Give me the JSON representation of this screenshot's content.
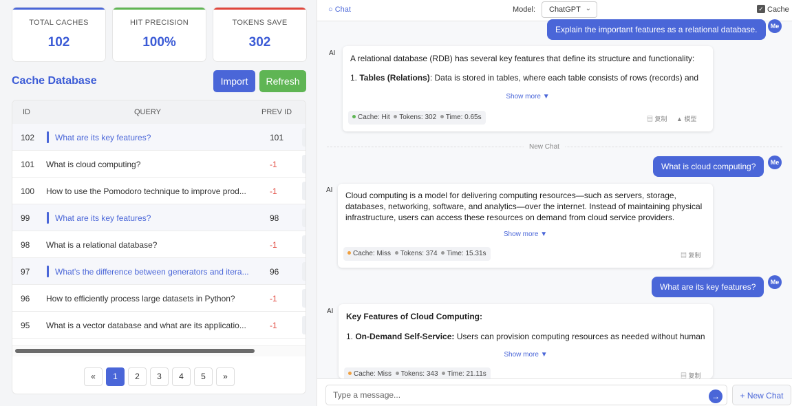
{
  "stats": [
    {
      "label": "TOTAL CACHES",
      "value": "102",
      "color": "#4a66d8"
    },
    {
      "label": "HIT PRECISION",
      "value": "100%",
      "color": "#5fb554"
    },
    {
      "label": "TOKENS SAVE",
      "value": "302",
      "color": "#e0463c"
    }
  ],
  "cache_db": {
    "title": "Cache Database",
    "import_label": "Import",
    "refresh_label": "Refresh",
    "columns": {
      "id": "ID",
      "query": "QUERY",
      "prev_id": "PREV ID"
    },
    "rows": [
      {
        "id": "102",
        "query": "What are its key features?",
        "prev_id": "101",
        "linked": true
      },
      {
        "id": "101",
        "query": "What is cloud computing?",
        "prev_id": "-1",
        "linked": false
      },
      {
        "id": "100",
        "query": "How to use the Pomodoro technique to improve prod...",
        "prev_id": "-1",
        "linked": false
      },
      {
        "id": "99",
        "query": "What are its key features?",
        "prev_id": "98",
        "linked": true
      },
      {
        "id": "98",
        "query": "What is a relational database?",
        "prev_id": "-1",
        "linked": false
      },
      {
        "id": "97",
        "query": "What's the difference between generators and itera...",
        "prev_id": "96",
        "linked": true
      },
      {
        "id": "96",
        "query": "How to efficiently process large datasets in Python?",
        "prev_id": "-1",
        "linked": false
      },
      {
        "id": "95",
        "query": "What is a vector database and what are its applicatio...",
        "prev_id": "-1",
        "linked": false
      }
    ],
    "pagination": {
      "prev": "«",
      "pages": [
        "1",
        "2",
        "3",
        "4",
        "5"
      ],
      "next": "»",
      "current": "1"
    }
  },
  "chat": {
    "tab_label": "Chat",
    "model_label": "Model:",
    "model_value": "ChatGPT",
    "cache_label": "Cache",
    "cache_checked": true,
    "new_chat_divider": "New Chat",
    "user_avatar": "Me",
    "ai_label": "AI",
    "show_more": "Show more ▼",
    "copy_label": "复制",
    "model_action_label": "模型",
    "messages": [
      {
        "role": "user",
        "text": "Explain the important features as a relational database."
      },
      {
        "role": "ai",
        "intro": "A relational database (RDB) has several key features that define its structure and functionality:",
        "point_title": "Tables (Relations)",
        "point_text": ": Data is stored in tables, where each table consists of rows (records) and",
        "cache": "Cache: Hit",
        "cache_color": "#5fb554",
        "tokens": "Tokens: 302",
        "time": "Time: 0.65s"
      },
      {
        "role": "user",
        "text": "What is cloud computing?"
      },
      {
        "role": "ai",
        "text": "Cloud computing is a model for delivering computing resources—such as servers, storage, databases, networking, software, and analytics—over the internet. Instead of maintaining physical infrastructure, users can access these resources on demand from cloud service providers.",
        "cache": "Cache: Miss",
        "cache_color": "#f0a040",
        "tokens": "Tokens: 374",
        "time": "Time: 15.31s"
      },
      {
        "role": "user",
        "text": "What are its key features?"
      },
      {
        "role": "ai",
        "heading": "Key Features of Cloud Computing:",
        "point_title": "On-Demand Self-Service:",
        "point_text": " Users can provision computing resources as needed without human",
        "cache": "Cache: Miss",
        "cache_color": "#f0a040",
        "tokens": "Tokens: 343",
        "time": "Time: 21.11s"
      }
    ],
    "input_placeholder": "Type a message...",
    "new_chat_button": "+ New Chat"
  }
}
